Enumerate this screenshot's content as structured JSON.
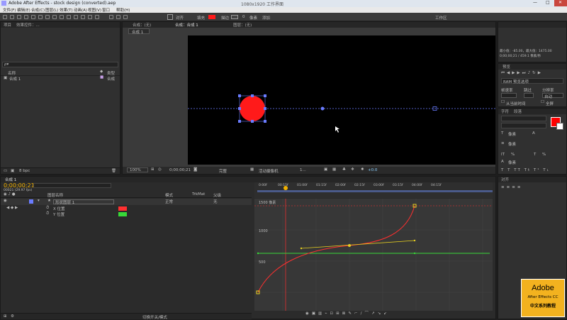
{
  "window": {
    "title": "Adobe After Effects - stock design (converted).aep",
    "center_title": "1080x1920 工作界面"
  },
  "menu": [
    "文件(F)",
    "编辑(E)",
    "合成(C)",
    "图层(L)",
    "效果(T)",
    "动画(A)",
    "视图(V)",
    "窗口",
    "帮助(H)"
  ],
  "toolbar": {
    "align_label": "对齐",
    "fill_label": "填充",
    "stroke_label": "描边",
    "stroke_width": "0",
    "pixel_label": "像素",
    "add_label": "添加",
    "workspace_label": "工作区"
  },
  "project_panel": {
    "tab_project": "项目",
    "tab_effects": "效果控件",
    "tab_layer": "效果控件：...",
    "search_placeholder": "ρ▾",
    "col_name": "名称",
    "col_type": "类型",
    "item_name": "合成 1",
    "item_type": "合成",
    "bpc": "8 bpc"
  },
  "comp_panel": {
    "tab_comp": "合成：(无)",
    "tab_comp_active": "合成：合成 1",
    "tab_footage": "图层：(无)",
    "breadcrumb": "合成 1",
    "zoom": "100%",
    "timecode": "0;00;00;21",
    "quality": "完整",
    "camera": "活动摄像机",
    "views": "1...",
    "offset": "+0.0"
  },
  "right_panel": {
    "info_lines": [
      "最小值：-85.00，最大值：1475.00",
      "0;00;00;21 / 459.1 像素/秒"
    ],
    "preview_title": "预览",
    "ram_label": "RAM 预览选项",
    "frame_rate_label": "帧速率",
    "skip_label": "跳过",
    "resolution_label": "分辨率",
    "auto_label": "自动",
    "from_current": "从当前时间",
    "fullscreen": "全屏",
    "char_tab": "字符",
    "para_tab": "段落",
    "align_tab": "对齐",
    "px_label": "像素",
    "percent_label": "%"
  },
  "timeline": {
    "tab_comp": "合成 1",
    "timecode": "0;00;00;21",
    "fps_sub": "00021 (29.97 fps)",
    "col_layer": "图层名称",
    "col_mode": "模式",
    "col_trkmat": "TrkMat",
    "col_parent": "父级",
    "layer_name": "形状图层 1",
    "layer_mode": "正常",
    "parent_value": "无",
    "props": [
      "X 位置",
      "Y 位置"
    ],
    "ruler": [
      "0:00f",
      "00:15f",
      "01:00f",
      "01:15f",
      "02:00f",
      "02:15f",
      "03:00f",
      "03:15f",
      "04:00f",
      "04:15f"
    ],
    "graph_labels": [
      "1500 像素",
      "1000",
      "500"
    ],
    "toggle_label": "切换开关/模式"
  },
  "logo": {
    "brand": "Adobe",
    "product": "After Effects CC",
    "series": "中文系列教程"
  },
  "colors": {
    "accent_orange": "#f0b000",
    "shape_red": "#ff1a1a",
    "curve_red": "#ff3030",
    "line_green": "#38d838",
    "handle_yellow": "#e8d020",
    "path_blue": "#6a7cff"
  }
}
